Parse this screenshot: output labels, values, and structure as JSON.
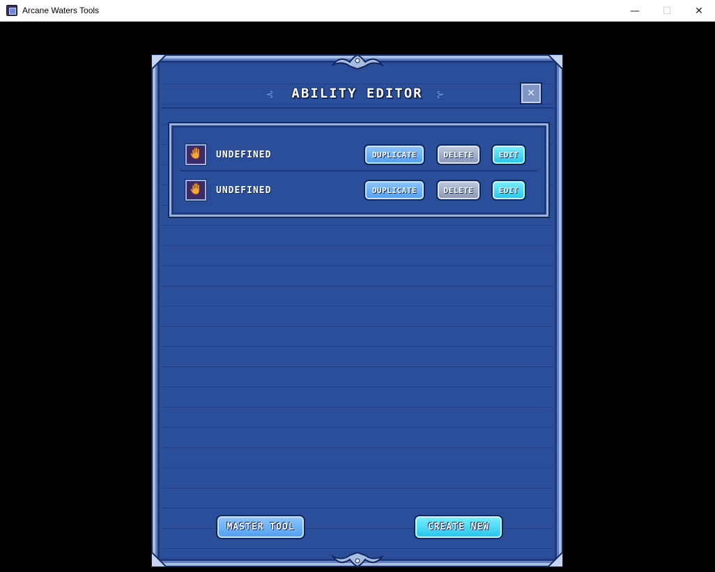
{
  "window": {
    "title": "Arcane Waters Tools",
    "minimize": "—",
    "maximize": "☐",
    "close": "✕"
  },
  "panel": {
    "title": "ABILITY EDITOR",
    "close_icon": "x-icon"
  },
  "abilities": [
    {
      "name": "UNDEFINED",
      "icon": "hand-icon",
      "duplicate_label": "DUPLICATE",
      "delete_label": "DELETE",
      "edit_label": "EDIT"
    },
    {
      "name": "UNDEFINED",
      "icon": "hand-icon",
      "duplicate_label": "DUPLICATE",
      "delete_label": "DELETE",
      "edit_label": "EDIT"
    }
  ],
  "footer": {
    "master_tool_label": "MASTER TOOL",
    "create_new_label": "CREATE NEW"
  },
  "colors": {
    "panel_bg": "#2b4e9a",
    "duplicate": "#4f9ef0",
    "delete": "#8794b4",
    "edit": "#22c4ea"
  }
}
